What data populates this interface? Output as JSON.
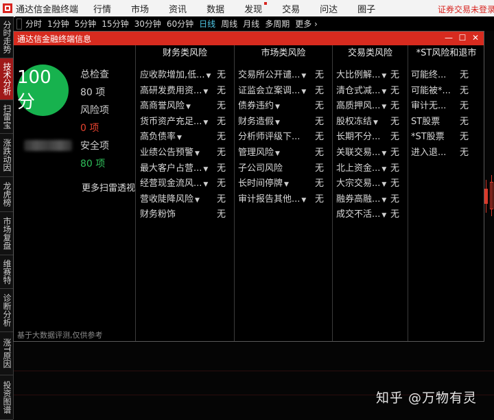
{
  "menubar": {
    "app_name": "通达信金融终端",
    "items": [
      "行情",
      "市场",
      "资讯",
      "数据",
      "发现",
      "交易",
      "问达",
      "圈子"
    ],
    "notice": "证券交易未登录"
  },
  "periods": [
    "分时",
    "1分钟",
    "5分钟",
    "15分钟",
    "30分钟",
    "60分钟",
    "日线",
    "周线",
    "月线",
    "多周期",
    "更多"
  ],
  "active_period": "日线",
  "left_tabs": [
    "分时走势",
    "技术分析",
    "扫雷宝",
    "涨跌动因",
    "龙虎榜",
    "市场复盘",
    "维赛特",
    "诊断分析",
    "涨T原因",
    "投资图谱"
  ],
  "active_left_tab": "技术分析",
  "dialog": {
    "title": "通达信金融终端信息",
    "score": "100分",
    "total_label": "总检查",
    "total_value": "80 项",
    "risk_label": "风险项",
    "risk_value": "0 项",
    "safe_label": "安全项",
    "safe_value": "80 项",
    "more_link": "更多扫雷透视",
    "footnote": "基于大数据评测,仅供参考",
    "colors": {
      "risk": "#e8432f",
      "safe": "#2fbf5a",
      "score_bg": "#17b24e",
      "title_bg": "#d72b1f"
    }
  },
  "columns": [
    {
      "title": "财务类风险",
      "rows": [
        {
          "label": "应收款增加,低...",
          "caret": true,
          "value": "无"
        },
        {
          "label": "高研发费用资...",
          "caret": true,
          "value": "无"
        },
        {
          "label": "高商誉风险",
          "caret": true,
          "value": "无"
        },
        {
          "label": "货币资产充足...",
          "caret": true,
          "value": "无"
        },
        {
          "label": "高负债率",
          "caret": true,
          "value": "无"
        },
        {
          "label": "业绩公告预警",
          "caret": true,
          "value": "无"
        },
        {
          "label": "最大客户占营...",
          "caret": true,
          "value": "无"
        },
        {
          "label": "经营现金流风...",
          "caret": true,
          "value": "无"
        },
        {
          "label": "营收陡降风险",
          "caret": true,
          "value": "无"
        },
        {
          "label": "财务粉饰",
          "caret": false,
          "value": "无"
        }
      ]
    },
    {
      "title": "市场类风险",
      "rows": [
        {
          "label": "交易所公开谴...",
          "caret": true,
          "value": "无"
        },
        {
          "label": "证监会立案调...",
          "caret": true,
          "value": "无"
        },
        {
          "label": "债券违约",
          "caret": true,
          "value": "无"
        },
        {
          "label": "财务造假",
          "caret": true,
          "value": "无"
        },
        {
          "label": "分析师评级下...",
          "caret": false,
          "value": "无"
        },
        {
          "label": "管理风险",
          "caret": true,
          "value": "无"
        },
        {
          "label": "子公司风险",
          "caret": false,
          "value": "无"
        },
        {
          "label": "长时间停牌",
          "caret": true,
          "value": "无"
        },
        {
          "label": "审计报告其他...",
          "caret": true,
          "value": "无"
        }
      ]
    },
    {
      "title": "交易类风险",
      "rows": [
        {
          "label": "大比例解...",
          "caret": true,
          "value": "无"
        },
        {
          "label": "清仓式减...",
          "caret": true,
          "value": "无"
        },
        {
          "label": "高质押风...",
          "caret": true,
          "value": "无"
        },
        {
          "label": "股权冻结",
          "caret": true,
          "value": "无"
        },
        {
          "label": "长期不分...",
          "caret": false,
          "value": "无"
        },
        {
          "label": "关联交易...",
          "caret": true,
          "value": "无"
        },
        {
          "label": "北上资金...",
          "caret": true,
          "value": "无"
        },
        {
          "label": "大宗交易...",
          "caret": true,
          "value": "无"
        },
        {
          "label": "融券高融...",
          "caret": true,
          "value": "无"
        },
        {
          "label": "成交不活...",
          "caret": true,
          "value": "无"
        }
      ]
    },
    {
      "title": "*ST风险和退市",
      "rows": [
        {
          "label": "可能终...",
          "caret": false,
          "value": "无"
        },
        {
          "label": "可能被*...",
          "caret": false,
          "value": "无"
        },
        {
          "label": "审计无...",
          "caret": false,
          "value": "无"
        },
        {
          "label": "ST股票",
          "caret": false,
          "value": "无"
        },
        {
          "label": "*ST股票",
          "caret": false,
          "value": "无"
        },
        {
          "label": "进入退...",
          "caret": false,
          "value": "无"
        }
      ]
    }
  ],
  "watermark": "知乎 @万物有灵"
}
